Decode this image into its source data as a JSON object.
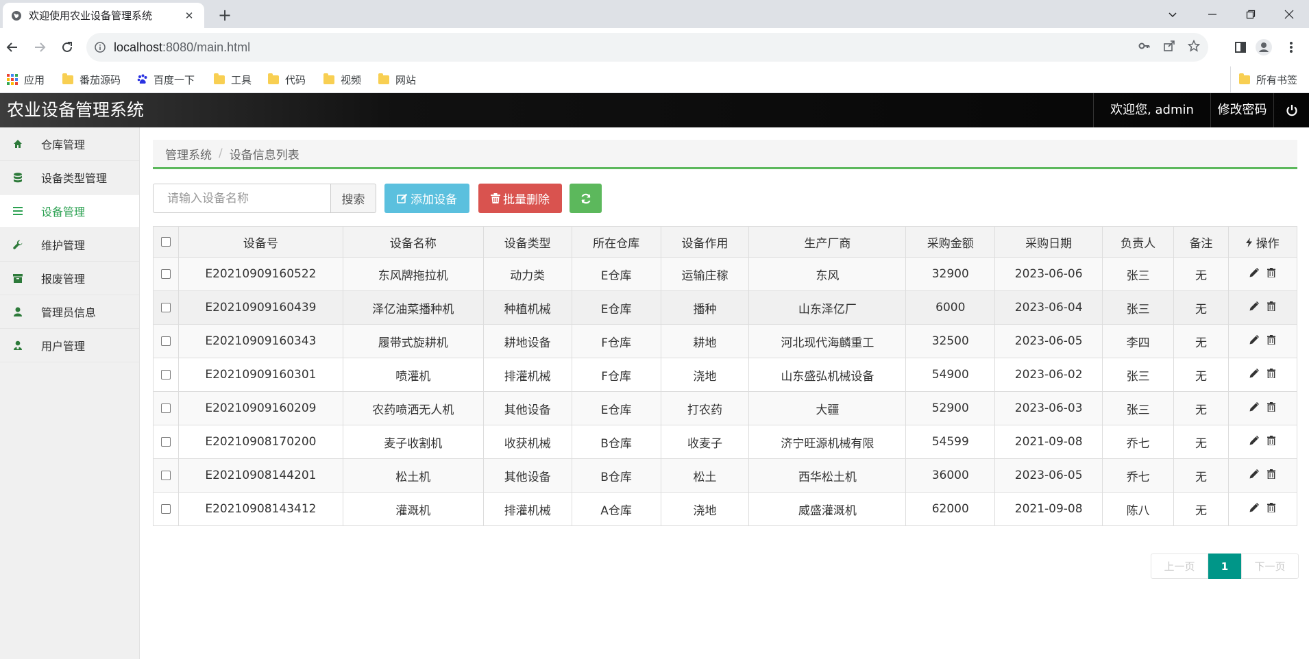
{
  "browser": {
    "tab_title": "欢迎使用农业设备管理系统",
    "url_host": "localhost",
    "url_path": ":8080/main.html",
    "bookmarks": [
      {
        "label": "应用",
        "icon": "apps-grid-icon"
      },
      {
        "label": "番茄源码",
        "icon": "folder-icon"
      },
      {
        "label": "百度一下",
        "icon": "baidu-paw-icon"
      },
      {
        "label": "工具",
        "icon": "folder-icon"
      },
      {
        "label": "代码",
        "icon": "folder-icon"
      },
      {
        "label": "视频",
        "icon": "folder-icon"
      },
      {
        "label": "网站",
        "icon": "folder-icon"
      }
    ],
    "all_bookmarks": "所有书签"
  },
  "header": {
    "title": "农业设备管理系统",
    "welcome": "欢迎您, admin",
    "change_password": "修改密码"
  },
  "sidebar": {
    "items": [
      {
        "label": "仓库管理",
        "icon": "home-icon",
        "active": false
      },
      {
        "label": "设备类型管理",
        "icon": "database-icon",
        "active": false
      },
      {
        "label": "设备管理",
        "icon": "list-icon",
        "active": true
      },
      {
        "label": "维护管理",
        "icon": "wrench-icon",
        "active": false
      },
      {
        "label": "报废管理",
        "icon": "archive-icon",
        "active": false
      },
      {
        "label": "管理员信息",
        "icon": "user-icon",
        "active": false
      },
      {
        "label": "用户管理",
        "icon": "users-icon",
        "active": false
      }
    ]
  },
  "breadcrumb": {
    "root": "管理系统",
    "current": "设备信息列表"
  },
  "search": {
    "placeholder": "请输入设备名称",
    "button": "搜索"
  },
  "actions": {
    "add": "添加设备",
    "batch_delete": "批量删除"
  },
  "table": {
    "columns": [
      "设备号",
      "设备名称",
      "设备类型",
      "所在仓库",
      "设备作用",
      "生产厂商",
      "采购金额",
      "采购日期",
      "负责人",
      "备注",
      "操作"
    ],
    "rows": [
      [
        "E20210909160522",
        "东风牌拖拉机",
        "动力类",
        "E仓库",
        "运输庄稼",
        "东风",
        "32900",
        "2023-06-06",
        "张三",
        "无"
      ],
      [
        "E20210909160439",
        "泽亿油菜播种机",
        "种植机械",
        "E仓库",
        "播种",
        "山东泽亿厂",
        "6000",
        "2023-06-04",
        "张三",
        "无"
      ],
      [
        "E20210909160343",
        "履带式旋耕机",
        "耕地设备",
        "F仓库",
        "耕地",
        "河北现代海麟重工",
        "32500",
        "2023-06-05",
        "李四",
        "无"
      ],
      [
        "E20210909160301",
        "喷灌机",
        "排灌机械",
        "F仓库",
        "浇地",
        "山东盛弘机械设备",
        "54900",
        "2023-06-02",
        "张三",
        "无"
      ],
      [
        "E20210909160209",
        "农药喷洒无人机",
        "其他设备",
        "E仓库",
        "打农药",
        "大疆",
        "52900",
        "2023-06-03",
        "张三",
        "无"
      ],
      [
        "E20210908170200",
        "麦子收割机",
        "收获机械",
        "B仓库",
        "收麦子",
        "济宁旺源机械有限",
        "54599",
        "2021-09-08",
        "乔七",
        "无"
      ],
      [
        "E20210908144201",
        "松土机",
        "其他设备",
        "B仓库",
        "松土",
        "西华松土机",
        "36000",
        "2023-06-05",
        "乔七",
        "无"
      ],
      [
        "E20210908143412",
        "灌溉机",
        "排灌机械",
        "A仓库",
        "浇地",
        "威盛灌溉机",
        "62000",
        "2021-09-08",
        "陈八",
        "无"
      ]
    ]
  },
  "pagination": {
    "prev": "上一页",
    "current": "1",
    "next": "下一页"
  },
  "colors": {
    "accent_green": "#5cb85c",
    "info": "#5bc0de",
    "danger": "#d9534f",
    "pager_active": "#009688"
  }
}
